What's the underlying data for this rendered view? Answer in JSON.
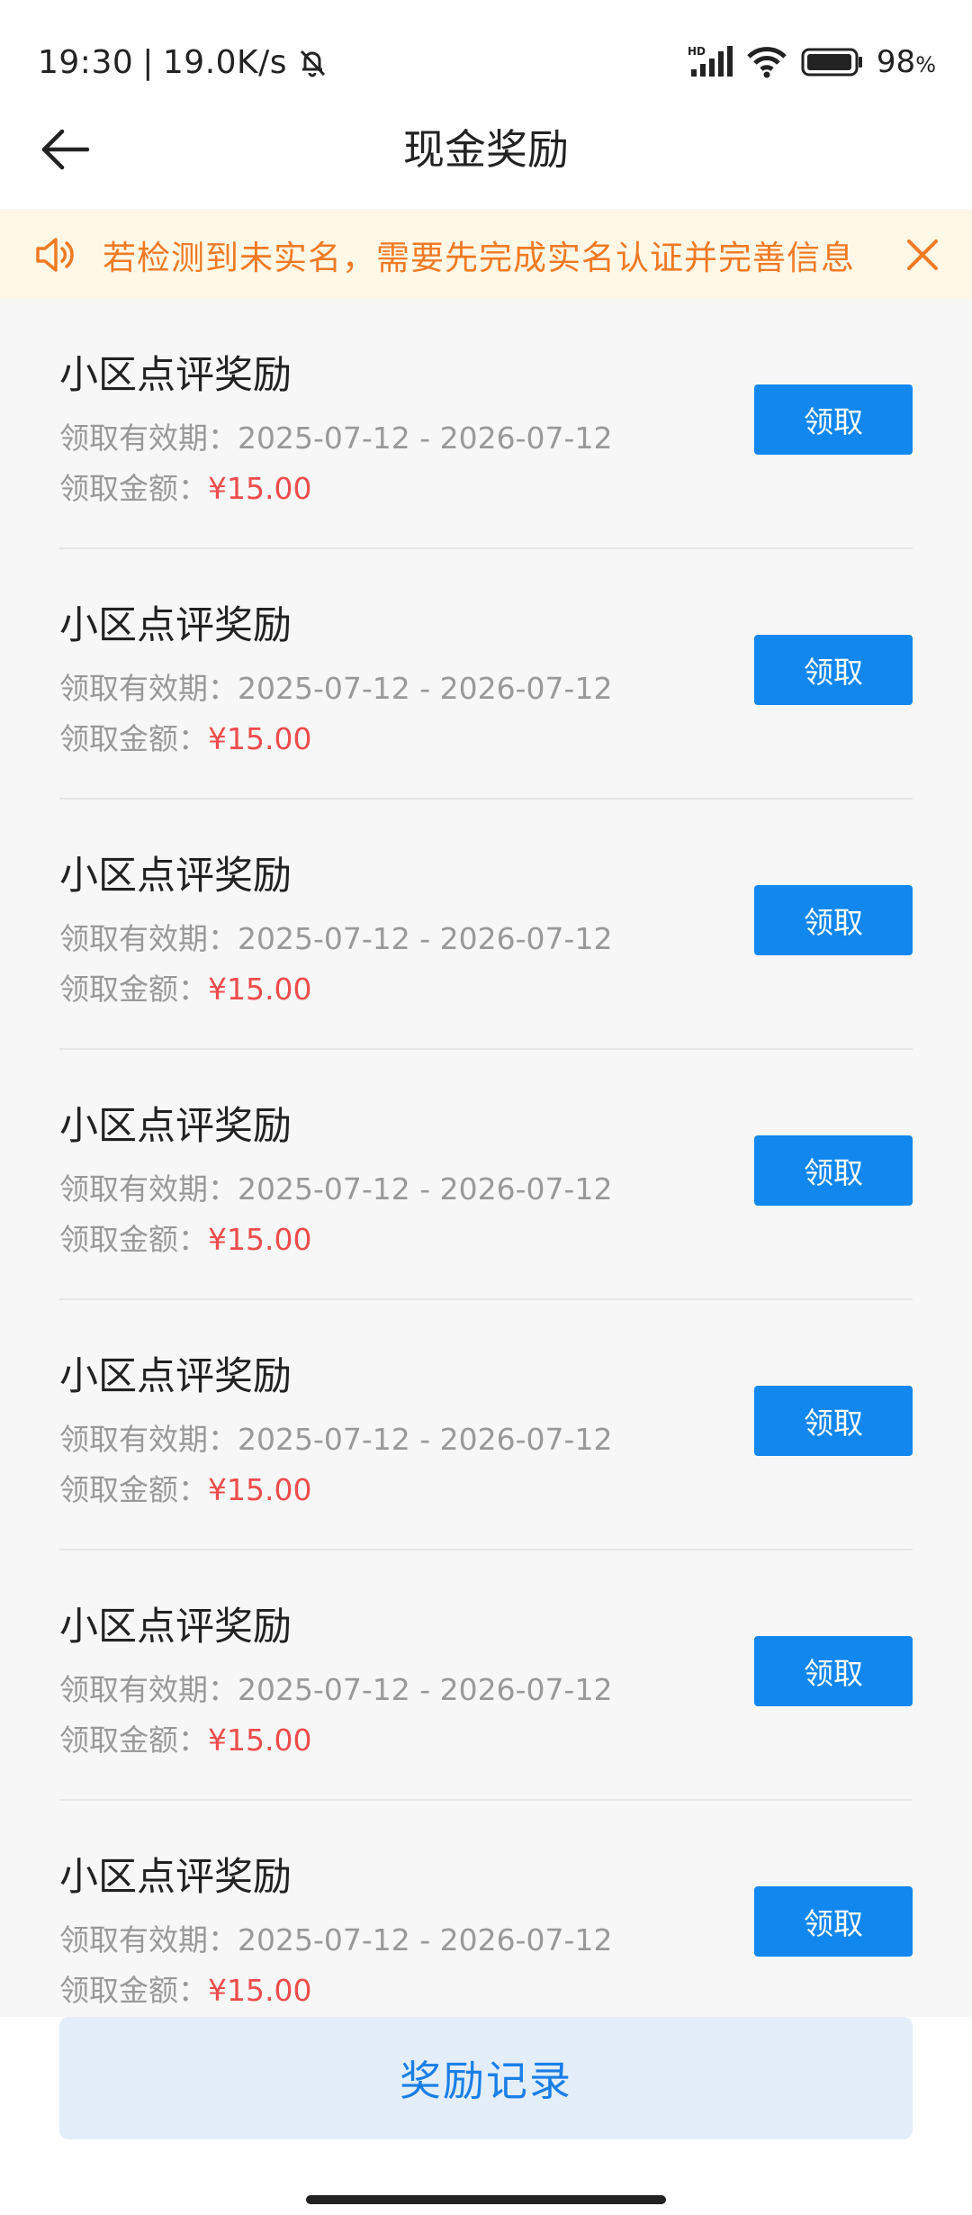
{
  "status_bar": {
    "time": "19:30",
    "separator": "|",
    "speed": "19.0K/s",
    "battery": "98",
    "battery_unit": "%",
    "icons": [
      "mute-bell-icon",
      "hd-signal-icon",
      "wifi-icon",
      "battery-icon"
    ]
  },
  "header": {
    "title": "现金奖励",
    "back_icon": "arrow-left-icon"
  },
  "notice": {
    "text": "若检测到未实名，需要先完成实名认证并完善信息",
    "icon": "speaker-icon",
    "close_icon": "close-icon"
  },
  "rewards": [
    {
      "title": "小区点评奖励",
      "period_label": "领取有效期：",
      "period": "2025-07-12 - 2026-07-12",
      "amount_label": "领取金额：",
      "amount": "¥15.00",
      "button": "领取"
    },
    {
      "title": "小区点评奖励",
      "period_label": "领取有效期：",
      "period": "2025-07-12 - 2026-07-12",
      "amount_label": "领取金额：",
      "amount": "¥15.00",
      "button": "领取"
    },
    {
      "title": "小区点评奖励",
      "period_label": "领取有效期：",
      "period": "2025-07-12 - 2026-07-12",
      "amount_label": "领取金额：",
      "amount": "¥15.00",
      "button": "领取"
    },
    {
      "title": "小区点评奖励",
      "period_label": "领取有效期：",
      "period": "2025-07-12 - 2026-07-12",
      "amount_label": "领取金额：",
      "amount": "¥15.00",
      "button": "领取"
    },
    {
      "title": "小区点评奖励",
      "period_label": "领取有效期：",
      "period": "2025-07-12 - 2026-07-12",
      "amount_label": "领取金额：",
      "amount": "¥15.00",
      "button": "领取"
    },
    {
      "title": "小区点评奖励",
      "period_label": "领取有效期：",
      "period": "2025-07-12 - 2026-07-12",
      "amount_label": "领取金额：",
      "amount": "¥15.00",
      "button": "领取"
    },
    {
      "title": "小区点评奖励",
      "period_label": "领取有效期：",
      "period": "2025-07-12 - 2026-07-12",
      "amount_label": "领取金额：",
      "amount": "¥15.00",
      "button": "领取"
    }
  ],
  "footer": {
    "records_button": "奖励记录"
  },
  "colors": {
    "primary": "#1287ee",
    "notice_text": "#f07a24",
    "notice_bg": "#fff8e6",
    "amount": "#ee4c4c",
    "records_bg": "#e3eefa"
  }
}
